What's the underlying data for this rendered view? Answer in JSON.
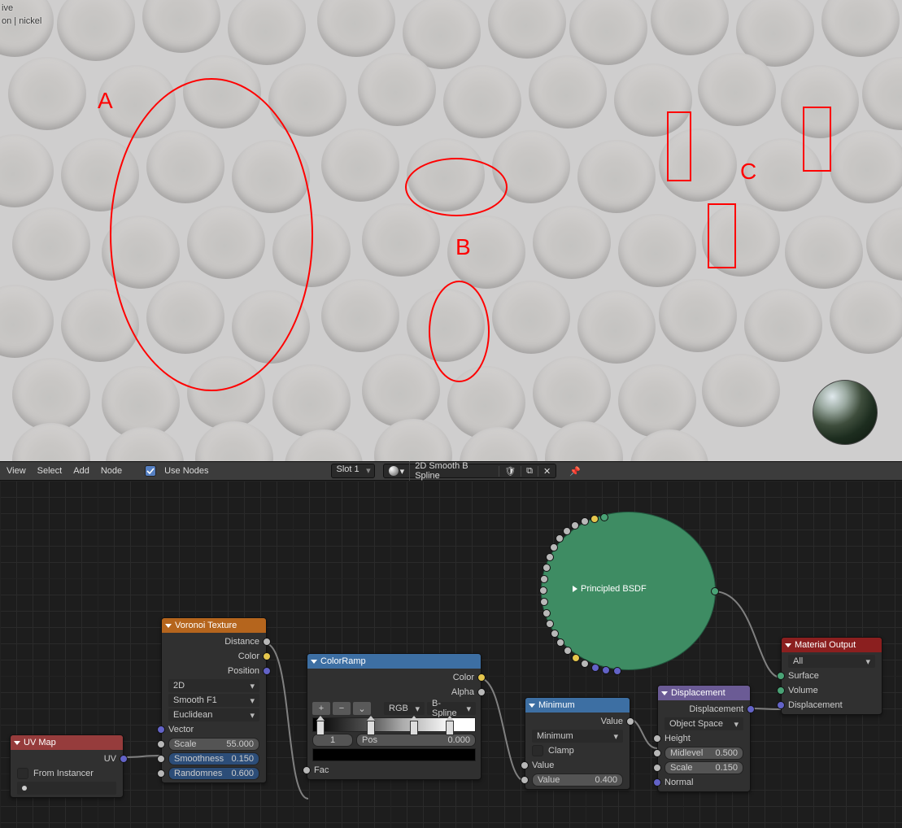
{
  "viewport": {
    "line1": "ive",
    "line2": "on | nickel",
    "annotations": {
      "a": "A",
      "b": "B",
      "c": "C"
    }
  },
  "header": {
    "menus": [
      "View",
      "Select",
      "Add",
      "Node"
    ],
    "use_nodes_label": "Use Nodes",
    "use_nodes_checked": true,
    "slot": "Slot 1",
    "material_name": "2D Smooth B Spline",
    "shield_icon": "shield",
    "duplicate_icon": "duplicate",
    "close_icon": "close",
    "pin_icon": "pin"
  },
  "nodes": {
    "uvmap": {
      "title": "UV Map",
      "uv_label": "UV",
      "from_instancer_label": "From Instancer",
      "from_instancer_checked": false,
      "field_value": ""
    },
    "voronoi": {
      "title": "Voronoi Texture",
      "outputs": {
        "distance": "Distance",
        "color": "Color",
        "position": "Position"
      },
      "dimensions": "2D",
      "feature": "Smooth F1",
      "metric": "Euclidean",
      "vector_label": "Vector",
      "scale_label": "Scale",
      "scale_value": "55.000",
      "smoothness_label": "Smoothness",
      "smoothness_value": "0.150",
      "randomness_label": "Randomnes",
      "randomness_value": "0.600"
    },
    "colorramp": {
      "title": "ColorRamp",
      "color_label": "Color",
      "alpha_label": "Alpha",
      "mode": "RGB",
      "interp": "B-Spline",
      "stop_index": "1",
      "pos_label": "Pos",
      "pos_value": "0.000",
      "fac_label": "Fac",
      "plus": "+",
      "minus": "−",
      "chevron": "⌄"
    },
    "minimum": {
      "title": "Minimum",
      "value_out": "Value",
      "operation": "Minimum",
      "clamp_label": "Clamp",
      "clamp_checked": false,
      "value_in1_label": "Value",
      "value_in2_label": "Value",
      "value_in2_value": "0.400"
    },
    "bsdf": {
      "title": "Principled BSDF"
    },
    "displacement": {
      "title": "Displacement",
      "disp_out": "Displacement",
      "space": "Object Space",
      "height_label": "Height",
      "midlevel_label": "Midlevel",
      "midlevel_value": "0.500",
      "scale_label": "Scale",
      "scale_value": "0.150",
      "normal_label": "Normal"
    },
    "material_output": {
      "title": "Material Output",
      "target": "All",
      "surface": "Surface",
      "volume": "Volume",
      "displacement": "Displacement"
    }
  }
}
